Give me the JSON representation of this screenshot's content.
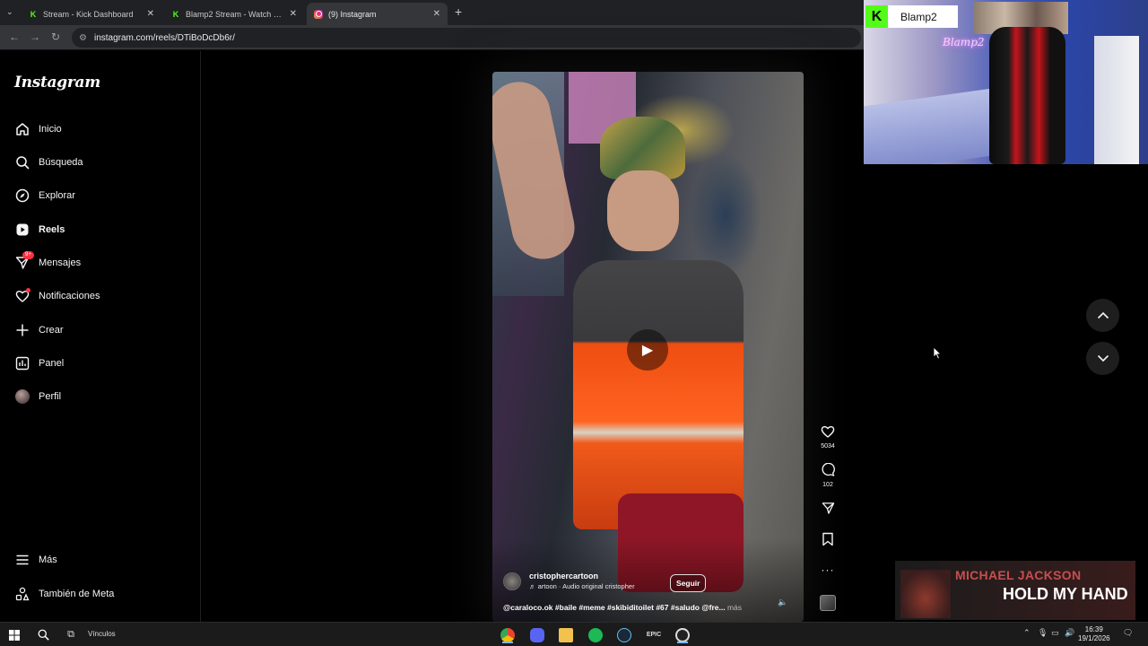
{
  "browser": {
    "tabs": [
      {
        "label": "Stream - Kick Dashboard",
        "favicon": "kick-icon"
      },
      {
        "label": "Blamp2 Stream - Watch Live on",
        "favicon": "kick-icon"
      },
      {
        "label": "(9) Instagram",
        "favicon": "instagram-icon",
        "active": true
      }
    ],
    "url": "instagram.com/reels/DTiBoDcDb6r/"
  },
  "sidebar": {
    "logo": "Instagram",
    "items": [
      {
        "label": "Inicio",
        "icon": "home-icon"
      },
      {
        "label": "Búsqueda",
        "icon": "search-icon"
      },
      {
        "label": "Explorar",
        "icon": "compass-icon"
      },
      {
        "label": "Reels",
        "icon": "reels-icon",
        "active": true
      },
      {
        "label": "Mensajes",
        "icon": "messages-icon",
        "badge": "9+"
      },
      {
        "label": "Notificaciones",
        "icon": "heart-icon"
      },
      {
        "label": "Crear",
        "icon": "plus-icon"
      },
      {
        "label": "Panel",
        "icon": "chart-icon"
      },
      {
        "label": "Perfil",
        "icon": "avatar"
      }
    ],
    "more": "Más",
    "meta": "También de Meta"
  },
  "reel": {
    "author": "cristophercartoon",
    "audio": "♬ artoon · Audio original  cristopher",
    "follow": "Seguir",
    "caption": "@caraloco.ok #baile #meme #skibiditoilet #67 #saludo @fre...",
    "caption_more": "más",
    "likes": "5034",
    "comments": "102"
  },
  "overlay": {
    "streamer": "Blamp2",
    "neon_sign": "Blamp2",
    "music_artist": "MICHAEL JACKSON",
    "music_title": "HOLD MY HAND"
  },
  "taskbar": {
    "search_label": "Vínculos",
    "time": "16:39",
    "date": "19/1/2026"
  }
}
